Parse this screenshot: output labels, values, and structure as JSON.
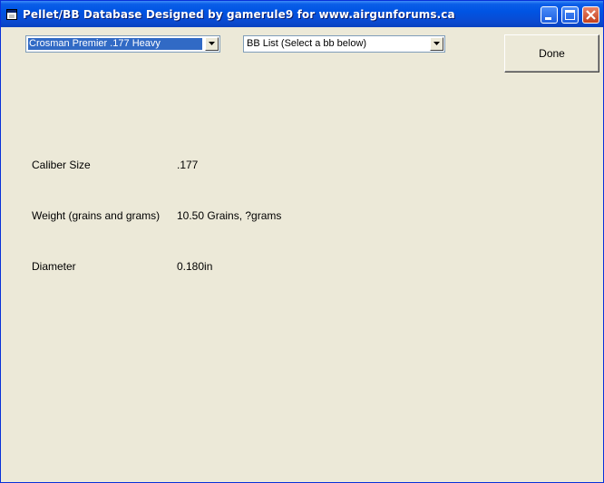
{
  "window": {
    "title": "Pellet/BB Database Designed by gamerule9 for www.airgunforums.ca",
    "controls": [
      "minimize-icon",
      "maximize-icon",
      "close-icon"
    ],
    "titlebar_color": "#0054e3",
    "background_color": "#ece9d8"
  },
  "pellet_combo": {
    "selected": "Crosman Premier .177 Heavy"
  },
  "bb_combo": {
    "selected": "BB List (Select a bb below)"
  },
  "done_button": {
    "label": "Done"
  },
  "fields": [
    {
      "label": "Caliber Size",
      "value": ".177"
    },
    {
      "label": "Weight (grains and grams)",
      "value": "10.50 Grains, ?grams"
    },
    {
      "label": "Diameter",
      "value": "0.180in"
    }
  ],
  "selection_color": "#316ac5"
}
